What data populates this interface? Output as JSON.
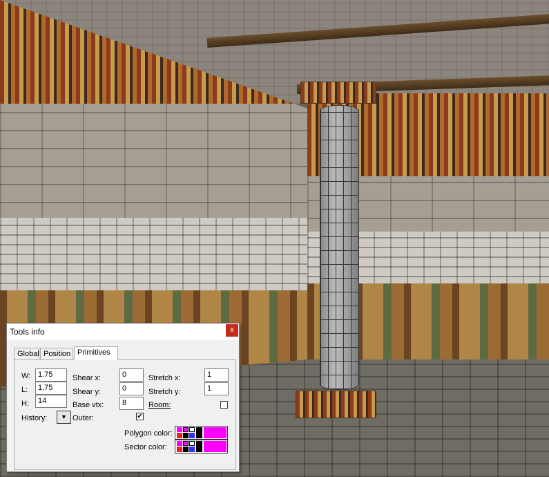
{
  "window": {
    "title": "Tools info",
    "close_glyph": "x"
  },
  "tabs": [
    {
      "label": "Global"
    },
    {
      "label": "Position"
    },
    {
      "label": "Primitives",
      "active": true
    }
  ],
  "primitives": {
    "w_label": "W:",
    "w_value": "1.75",
    "l_label": "L:",
    "l_value": "1.75",
    "h_label": "H:",
    "h_value": "14",
    "shear_x_label": "Shear x:",
    "shear_x_value": "0",
    "shear_y_label": "Shear y:",
    "shear_y_value": "0",
    "base_vtx_label": "Base vtx:",
    "base_vtx_value": "8",
    "stretch_x_label": "Stretch x:",
    "stretch_x_value": "1",
    "stretch_y_label": "Stretch y:",
    "stretch_y_value": "1",
    "room_label": "Room:",
    "room_checked": false,
    "history_label": "History:",
    "history_glyph": "▼",
    "outer_label": "Outer:",
    "outer_checked": true,
    "outer_mark": "✔",
    "polygon_color_label": "Polygon color:",
    "sector_color_label": "Sector color:"
  },
  "colors": {
    "accent_selected": "#ff00ff",
    "close_button": "#c42b1c",
    "palette_swatches": [
      "#ff00ff",
      "#e82020",
      "#3030ff",
      "#ffffff",
      "#000000",
      "#202020"
    ]
  },
  "icons": {
    "close": "close-icon",
    "history_dropdown": "chevron-down-icon",
    "outer_check": "checkmark-icon"
  }
}
